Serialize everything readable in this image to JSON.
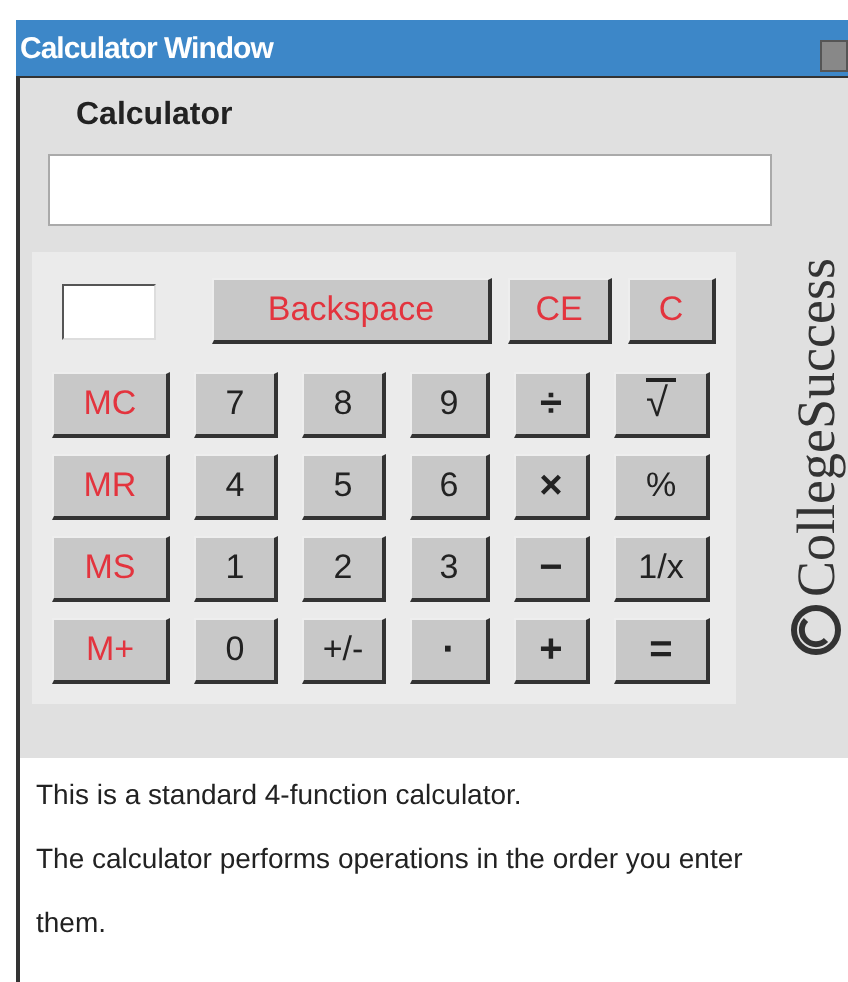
{
  "window": {
    "title": "Calculator Window"
  },
  "heading": "Calculator",
  "top_row": [
    {
      "label": "Backspace",
      "kind": "clear"
    },
    {
      "label": "CE",
      "kind": "clear"
    },
    {
      "label": "C",
      "kind": "clear"
    }
  ],
  "keypad": [
    [
      {
        "label": "MC",
        "kind": "memory"
      },
      {
        "label": "7",
        "kind": "digit"
      },
      {
        "label": "8",
        "kind": "digit"
      },
      {
        "label": "9",
        "kind": "digit"
      },
      {
        "label": "÷",
        "kind": "operator"
      },
      {
        "label": "√",
        "kind": "root"
      }
    ],
    [
      {
        "label": "MR",
        "kind": "memory"
      },
      {
        "label": "4",
        "kind": "digit"
      },
      {
        "label": "5",
        "kind": "digit"
      },
      {
        "label": "6",
        "kind": "digit"
      },
      {
        "label": "×",
        "kind": "operator"
      },
      {
        "label": "%",
        "kind": "digit"
      }
    ],
    [
      {
        "label": "MS",
        "kind": "memory"
      },
      {
        "label": "1",
        "kind": "digit"
      },
      {
        "label": "2",
        "kind": "digit"
      },
      {
        "label": "3",
        "kind": "digit"
      },
      {
        "label": "−",
        "kind": "operator"
      },
      {
        "label": "1/x",
        "kind": "digit"
      }
    ],
    [
      {
        "label": "M+",
        "kind": "memory"
      },
      {
        "label": "0",
        "kind": "digit"
      },
      {
        "label": "+/-",
        "kind": "digit"
      },
      {
        "label": "·",
        "kind": "operator"
      },
      {
        "label": "+",
        "kind": "operator"
      },
      {
        "label": "=",
        "kind": "operator"
      }
    ]
  ],
  "logo": {
    "text": "CollegeSuccess"
  },
  "description": [
    "This is a standard 4-function calculator.",
    "The calculator performs operations in the order you enter them."
  ]
}
